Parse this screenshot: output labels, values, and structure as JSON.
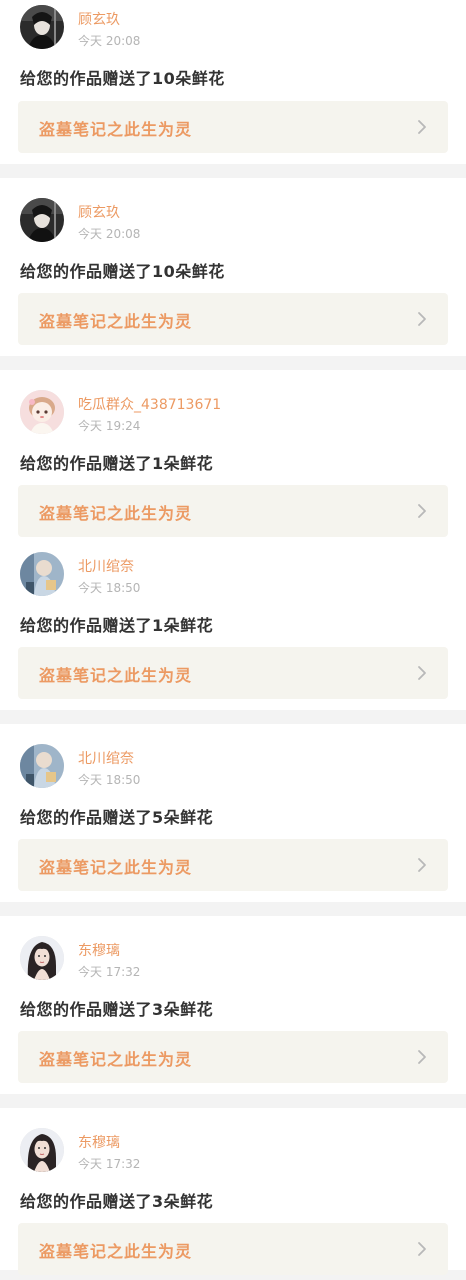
{
  "notifications": [
    {
      "user": "顾玄玖",
      "time": "今天 20:08",
      "message": "给您的作品赠送了10朵鲜花",
      "work": "盗墓笔记之此生为灵",
      "avatar_icon": "dark-portrait-avatar"
    },
    {
      "user": "顾玄玖",
      "time": "今天 20:08",
      "message": "给您的作品赠送了10朵鲜花",
      "work": "盗墓笔记之此生为灵",
      "avatar_icon": "dark-portrait-avatar"
    },
    {
      "user": "吃瓜群众_438713671",
      "time": "今天 19:24",
      "message": "给您的作品赠送了1朵鲜花",
      "work": "盗墓笔记之此生为灵",
      "avatar_icon": "pink-doll-avatar"
    },
    {
      "user": "北川绾奈",
      "time": "今天 18:50",
      "message": "给您的作品赠送了1朵鲜花",
      "work": "盗墓笔记之此生为灵",
      "avatar_icon": "blue-figure-avatar"
    },
    {
      "user": "北川绾奈",
      "time": "今天 18:50",
      "message": "给您的作品赠送了5朵鲜花",
      "work": "盗墓笔记之此生为灵",
      "avatar_icon": "blue-figure-avatar"
    },
    {
      "user": "东穆璃",
      "time": "今天 17:32",
      "message": "给您的作品赠送了3朵鲜花",
      "work": "盗墓笔记之此生为灵",
      "avatar_icon": "girl-portrait-avatar"
    },
    {
      "user": "东穆璃",
      "time": "今天 17:32",
      "message": "给您的作品赠送了3朵鲜花",
      "work": "盗墓笔记之此生为灵",
      "avatar_icon": "girl-portrait-avatar"
    }
  ],
  "colors": {
    "accent": "#ec9a63",
    "text": "#333333",
    "muted": "#b5b5b5",
    "work_bg": "#f5f4ee",
    "page_bg": "#f3f3f3"
  }
}
